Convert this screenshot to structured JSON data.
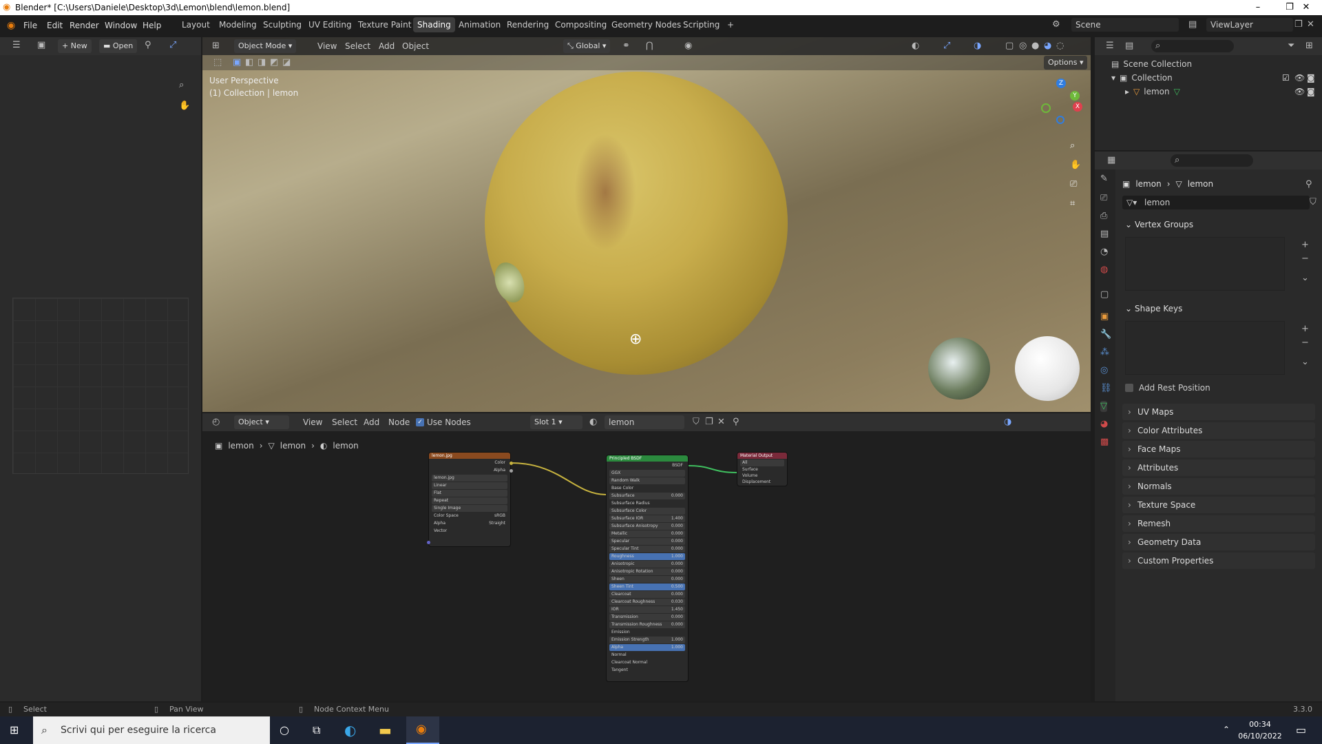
{
  "window": {
    "title": "Blender* [C:\\Users\\Daniele\\Desktop\\3d\\Lemon\\blend\\lemon.blend]"
  },
  "menu": [
    "File",
    "Edit",
    "Render",
    "Window",
    "Help"
  ],
  "workspaces": [
    "Layout",
    "Modeling",
    "Sculpting",
    "UV Editing",
    "Texture Paint",
    "Shading",
    "Animation",
    "Rendering",
    "Compositing",
    "Geometry Nodes",
    "Scripting"
  ],
  "active_workspace": "Shading",
  "scene": {
    "label": "Scene",
    "viewlayer": "ViewLayer"
  },
  "filebrowser": {
    "new": "New",
    "open": "Open"
  },
  "viewport": {
    "mode": "Object Mode",
    "menus": [
      "View",
      "Select",
      "Add",
      "Object"
    ],
    "orientation": "Global",
    "options": "Options",
    "perspective": "User Perspective",
    "collection_info": "(1) Collection | lemon"
  },
  "nodeeditor": {
    "type": "Object",
    "menus": [
      "View",
      "Select",
      "Add",
      "Node"
    ],
    "use_nodes": "Use Nodes",
    "slot": "Slot 1",
    "material": "lemon",
    "breadcrumb": [
      "lemon",
      "lemon",
      "lemon"
    ],
    "image_node": {
      "title": "lemon.jpg",
      "outputs": [
        "Color",
        "Alpha"
      ],
      "file": "lemon.jpg",
      "rows": [
        "Linear",
        "Flat",
        "Repeat",
        "Single Image"
      ],
      "colorspace_label": "Color Space",
      "colorspace": "sRGB",
      "alpha_label": "Alpha",
      "alpha": "Straight",
      "input": "Vector"
    },
    "bsdf_node": {
      "title": "Principled BSDF",
      "output": "BSDF",
      "dist": "GGX",
      "sss": "Random Walk",
      "rows": [
        [
          "Base Color",
          ""
        ],
        [
          "Subsurface",
          "0.000"
        ],
        [
          "Subsurface Radius",
          ""
        ],
        [
          "Subsurface Color",
          ""
        ],
        [
          "Subsurface IOR",
          "1.400"
        ],
        [
          "Subsurface Anisotropy",
          "0.000"
        ],
        [
          "Metallic",
          "0.000"
        ],
        [
          "Specular",
          "0.000"
        ],
        [
          "Specular Tint",
          "0.000"
        ],
        [
          "Roughness",
          "1.000"
        ],
        [
          "Anisotropic",
          "0.000"
        ],
        [
          "Anisotropic Rotation",
          "0.000"
        ],
        [
          "Sheen",
          "0.000"
        ],
        [
          "Sheen Tint",
          "0.500"
        ],
        [
          "Clearcoat",
          "0.000"
        ],
        [
          "Clearcoat Roughness",
          "0.030"
        ],
        [
          "IOR",
          "1.450"
        ],
        [
          "Transmission",
          "0.000"
        ],
        [
          "Transmission Roughness",
          "0.000"
        ],
        [
          "Emission",
          ""
        ],
        [
          "Emission Strength",
          "1.000"
        ],
        [
          "Alpha",
          "1.000"
        ],
        [
          "Normal",
          ""
        ],
        [
          "Clearcoat Normal",
          ""
        ],
        [
          "Tangent",
          ""
        ]
      ],
      "highlight": [
        "Roughness",
        "Sheen Tint",
        "Alpha"
      ]
    },
    "output_node": {
      "title": "Material Output",
      "target": "All",
      "inputs": [
        "Surface",
        "Volume",
        "Displacement"
      ]
    }
  },
  "outliner": {
    "scene_collection": "Scene Collection",
    "collection": "Collection",
    "object": "lemon"
  },
  "properties": {
    "breadcrumb": [
      "lemon",
      "lemon"
    ],
    "mesh_name": "lemon",
    "panels": {
      "vertex_groups": "Vertex Groups",
      "shape_keys": "Shape Keys",
      "add_rest": "Add Rest Position"
    },
    "collapsed": [
      "UV Maps",
      "Color Attributes",
      "Face Maps",
      "Attributes",
      "Normals",
      "Texture Space",
      "Remesh",
      "Geometry Data",
      "Custom Properties"
    ]
  },
  "status": {
    "select": "Select",
    "pan": "Pan View",
    "context": "Node Context Menu",
    "version": "3.3.0"
  },
  "taskbar": {
    "search": "Scrivi qui per eseguire la ricerca",
    "time": "00:34",
    "date": "06/10/2022"
  }
}
